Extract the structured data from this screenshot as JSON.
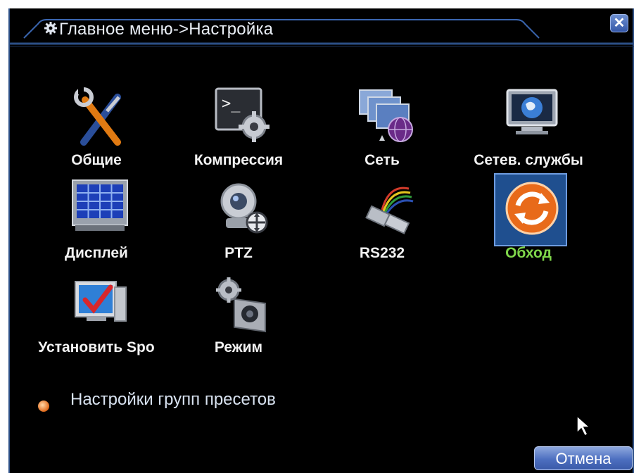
{
  "window": {
    "title": "Главное меню->Настройка",
    "close_icon": "close-icon"
  },
  "tiles": [
    {
      "label": "Общие",
      "icon": "tools-icon"
    },
    {
      "label": "Компрессия",
      "icon": "terminal-gear-icon"
    },
    {
      "label": "Сеть",
      "icon": "network-icon"
    },
    {
      "label": "Сетев. службы",
      "icon": "globe-monitor-icon"
    },
    {
      "label": "Дисплей",
      "icon": "display-grid-icon"
    },
    {
      "label": "PTZ",
      "icon": "ptz-camera-icon"
    },
    {
      "label": "RS232",
      "icon": "serial-cable-icon"
    },
    {
      "label": "Обход",
      "icon": "refresh-icon",
      "selected": true
    },
    {
      "label": "Установить Spo",
      "icon": "spot-monitor-icon"
    },
    {
      "label": "Режим",
      "icon": "camera-mode-icon"
    }
  ],
  "preset_label": "Настройки групп пресетов",
  "cancel_label": "Отмена",
  "colors": {
    "accent": "#2c4f86",
    "selected_label": "#7fd64a",
    "button": "#4d6fc0"
  }
}
